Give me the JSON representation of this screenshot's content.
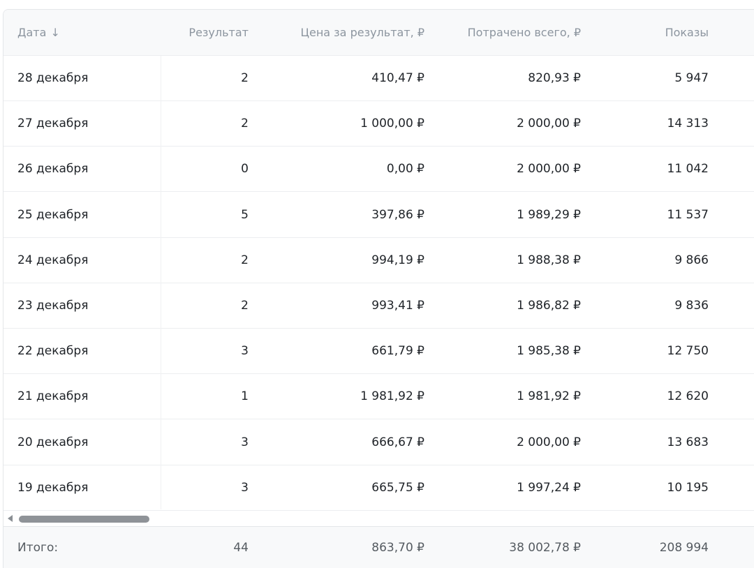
{
  "columns": {
    "date": "Дата",
    "date_sort_icon": "arrow-down-icon",
    "date_sort_glyph": "↓",
    "result": "Результат",
    "price": "Цена за результат, ₽",
    "spent": "Потрачено всего, ₽",
    "shows": "Показы"
  },
  "rows": [
    {
      "date": "28 декабря",
      "result": "2",
      "price": "410,47 ₽",
      "spent": "820,93 ₽",
      "shows": "5 947"
    },
    {
      "date": "27 декабря",
      "result": "2",
      "price": "1 000,00 ₽",
      "spent": "2 000,00 ₽",
      "shows": "14 313"
    },
    {
      "date": "26 декабря",
      "result": "0",
      "price": "0,00 ₽",
      "spent": "2 000,00 ₽",
      "shows": "11 042"
    },
    {
      "date": "25 декабря",
      "result": "5",
      "price": "397,86 ₽",
      "spent": "1 989,29 ₽",
      "shows": "11 537"
    },
    {
      "date": "24 декабря",
      "result": "2",
      "price": "994,19 ₽",
      "spent": "1 988,38 ₽",
      "shows": "9 866"
    },
    {
      "date": "23 декабря",
      "result": "2",
      "price": "993,41 ₽",
      "spent": "1 986,82 ₽",
      "shows": "9 836"
    },
    {
      "date": "22 декабря",
      "result": "3",
      "price": "661,79 ₽",
      "spent": "1 985,38 ₽",
      "shows": "12 750"
    },
    {
      "date": "21 декабря",
      "result": "1",
      "price": "1 981,92 ₽",
      "spent": "1 981,92 ₽",
      "shows": "12 620"
    },
    {
      "date": "20 декабря",
      "result": "3",
      "price": "666,67 ₽",
      "spent": "2 000,00 ₽",
      "shows": "13 683"
    },
    {
      "date": "19 декабря",
      "result": "3",
      "price": "665,75 ₽",
      "spent": "1 997,24 ₽",
      "shows": "10 195"
    }
  ],
  "totals": {
    "label": "Итого:",
    "result": "44",
    "price": "863,70 ₽",
    "spent": "38 002,78 ₽",
    "shows": "208 994"
  },
  "scrollbar": {
    "left_arrow_icon": "triangle-left-icon"
  },
  "colors": {
    "header_bg": "#f8f9fa",
    "header_text": "#8c959f",
    "body_text": "#1f2328",
    "border": "#eceef0",
    "scroll_thumb": "#8f9398"
  }
}
